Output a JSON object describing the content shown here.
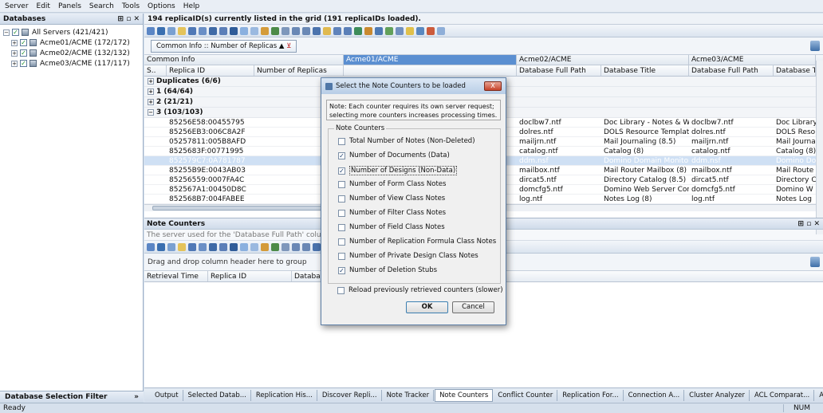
{
  "menu": [
    "Server",
    "Edit",
    "Panels",
    "Search",
    "Tools",
    "Options",
    "Help"
  ],
  "left_panel": {
    "title": "Databases",
    "tree": [
      {
        "label": "All Servers  (421/421)"
      },
      {
        "label": "Acme01/ACME  (172/172)"
      },
      {
        "label": "Acme02/ACME  (132/132)"
      },
      {
        "label": "Acme03/ACME  (117/117)"
      }
    ],
    "filter_label": "Database Selection Filter"
  },
  "grid": {
    "info": "194 replicaID(s) currently listed in the grid (191 replicaIDs loaded).",
    "group_chip": "Common Info :: Number of Replicas",
    "bands": [
      "Common Info",
      "Acme01/ACME",
      "Acme02/ACME",
      "Acme03/ACME"
    ],
    "columns": [
      "S..",
      "Replica ID",
      "Number of Replicas",
      "Database Full Path",
      "Database Title",
      "Database Full Path",
      "Database T"
    ],
    "groups": [
      "Duplicates (6/6)",
      "1 (64/64)",
      "2 (21/21)",
      "3 (103/103)"
    ],
    "rows": [
      {
        "id": "85256E58:00455795",
        "p1": "doclbw7.ntf",
        "t2": "Doc Library - Notes & We...",
        "p3": "doclbw7.ntf",
        "t3": "Doc Library"
      },
      {
        "id": "85256EB3:006C8A2F",
        "p1": "dolres.ntf",
        "t2": "DOLS Resource Template",
        "p3": "dolres.ntf",
        "t3": "DOLS Reso"
      },
      {
        "id": "05257811:005B8AFD",
        "p1": "mailjrn.ntf",
        "t2": "Mail Journaling (8.5)",
        "p3": "mailjrn.ntf",
        "t3": "Mail Journal"
      },
      {
        "id": "8525683F:00771995",
        "p1": "catalog.ntf",
        "t2": "Catalog (8)",
        "p3": "catalog.ntf",
        "t3": "Catalog (8)"
      },
      {
        "id": "852579C7:0A781787",
        "p1": "ddm.nsf",
        "t2": "Domino Domain Monitor...",
        "p3": "ddm.nsf",
        "t3": "Domino Do"
      },
      {
        "id": "85255B9E:0043AB03",
        "p1": "mailbox.ntf",
        "t2": "Mail Router Mailbox (8)",
        "p3": "mailbox.ntf",
        "t3": "Mail Route"
      },
      {
        "id": "85256559:0007FA4C",
        "p1": "dircat5.ntf",
        "t2": "Directory Catalog (8.5)",
        "p3": "dircat5.ntf",
        "t3": "Directory C"
      },
      {
        "id": "852567A1:00450D8C",
        "p1": "domcfg5.ntf",
        "t2": "Domino Web Server Conf...",
        "p3": "domcfg5.ntf",
        "t3": "Domino W"
      },
      {
        "id": "852568B7:004FABEE",
        "p1": "log.ntf",
        "t2": "Notes Log (8)",
        "p3": "log.ntf",
        "t3": "Notes Log"
      }
    ]
  },
  "note_counters": {
    "title": "Note Counters",
    "desc": "The server used for the 'Database Full Path' column is: Ne",
    "drag_hint": "Drag and drop column header here to group",
    "columns": [
      "Retrieval Time",
      "Replica ID",
      "Databas"
    ]
  },
  "tabs": [
    "Output",
    "Selected Datab...",
    "Replication His...",
    "Discover Repli...",
    "Note Tracker",
    "Note Counters",
    "Conflict Counter",
    "Replication For...",
    "Connection A...",
    "Cluster Analyzer",
    "ACL Comparat...",
    "Agent Compar..."
  ],
  "status": {
    "left": "Ready",
    "right": "NUM"
  },
  "dialog": {
    "title": "Select the Note Counters to be loaded",
    "close": "X",
    "note": "Note: Each counter requires its own server request; selecting more counters increases processing times.",
    "group_label": "Note Counters",
    "options": [
      {
        "label": "Total Number of Notes (Non-Deleted)",
        "checked": false
      },
      {
        "label": "Number of Documents (Data)",
        "checked": true
      },
      {
        "label": "Number of Designs (Non-Data)",
        "checked": true
      },
      {
        "label": "Number of Form Class Notes",
        "checked": false
      },
      {
        "label": "Number of View Class Notes",
        "checked": false
      },
      {
        "label": "Number of Filter Class Notes",
        "checked": false
      },
      {
        "label": "Number of Field Class Notes",
        "checked": false
      },
      {
        "label": "Number of Replication Formula Class Notes",
        "checked": false
      },
      {
        "label": "Number of Private Design Class Notes",
        "checked": false
      },
      {
        "label": "Number of Deletion Stubs",
        "checked": true
      }
    ],
    "reload_label": "Reload previously retrieved counters (slower)",
    "ok": "OK",
    "cancel": "Cancel"
  }
}
